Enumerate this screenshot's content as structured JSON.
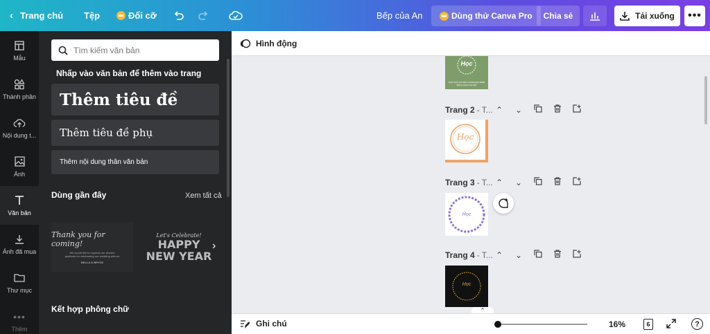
{
  "topbar": {
    "home": "Trang chủ",
    "file": "Tệp",
    "resize": "Đổi cỡ",
    "owner": "Bếp của An",
    "try_pro": "Dùng thử Canva Pro",
    "share": "Chia sẻ",
    "download": "Tải xuống"
  },
  "rail": [
    {
      "label": "Mẫu",
      "icon": "layout-icon"
    },
    {
      "label": "Thành phần",
      "icon": "shapes-icon"
    },
    {
      "label": "Nội dung t...",
      "icon": "upload-icon"
    },
    {
      "label": "Ảnh",
      "icon": "image-icon"
    },
    {
      "label": "Văn bản",
      "icon": "text-icon"
    },
    {
      "label": "Ảnh đã mua",
      "icon": "download-icon"
    },
    {
      "label": "Thư mục",
      "icon": "folder-icon"
    },
    {
      "label": "Thêm",
      "icon": "more-icon"
    }
  ],
  "panel": {
    "search_placeholder": "Tìm kiếm văn bản",
    "hint": "Nhấp vào văn bản để thêm vào trang",
    "heading": "Thêm tiêu đề",
    "subheading": "Thêm tiêu đề phụ",
    "body": "Thêm nội dung thân văn bản",
    "recent_title": "Dùng gần đây",
    "see_all": "Xem tất cả",
    "recent": [
      {
        "main": "Thank you for coming!",
        "sub": "We would like to express our sincere gratitude for celebrating our wedding with us",
        "footer": "BELLA & BRYCE"
      },
      {
        "top": "Let's Celebrate!",
        "big1": "HAPPY",
        "big2": "NEW YEAR"
      }
    ],
    "combo_title": "Kết hợp phông chữ"
  },
  "subbar": {
    "animate": "Hình động"
  },
  "pages": [
    {
      "name": "Trang 2",
      "rest": "- T...",
      "thumb_text": "Học",
      "thumb_bg": "#ffffff",
      "accent": "#f0a26a"
    },
    {
      "name": "Trang 3",
      "rest": "- T...",
      "thumb_text": "Học",
      "thumb_bg": "#ffffff",
      "accent": "#8e76d6"
    },
    {
      "name": "Trang 4",
      "rest": "- T...",
      "thumb_text": "Học",
      "thumb_bg": "#111111",
      "accent": "#d9a53a"
    }
  ],
  "page1_thumb": {
    "text": "Học",
    "bg": "#7f9d6b",
    "caption": "PHỞ NHÀ TRUYỀN THỐNG ĐỊA ĐIỂM BÁCH KHOA HÀ NỘI"
  },
  "bottombar": {
    "notes": "Ghi chú",
    "zoom": "16%",
    "page_count": "6",
    "help": "?"
  }
}
